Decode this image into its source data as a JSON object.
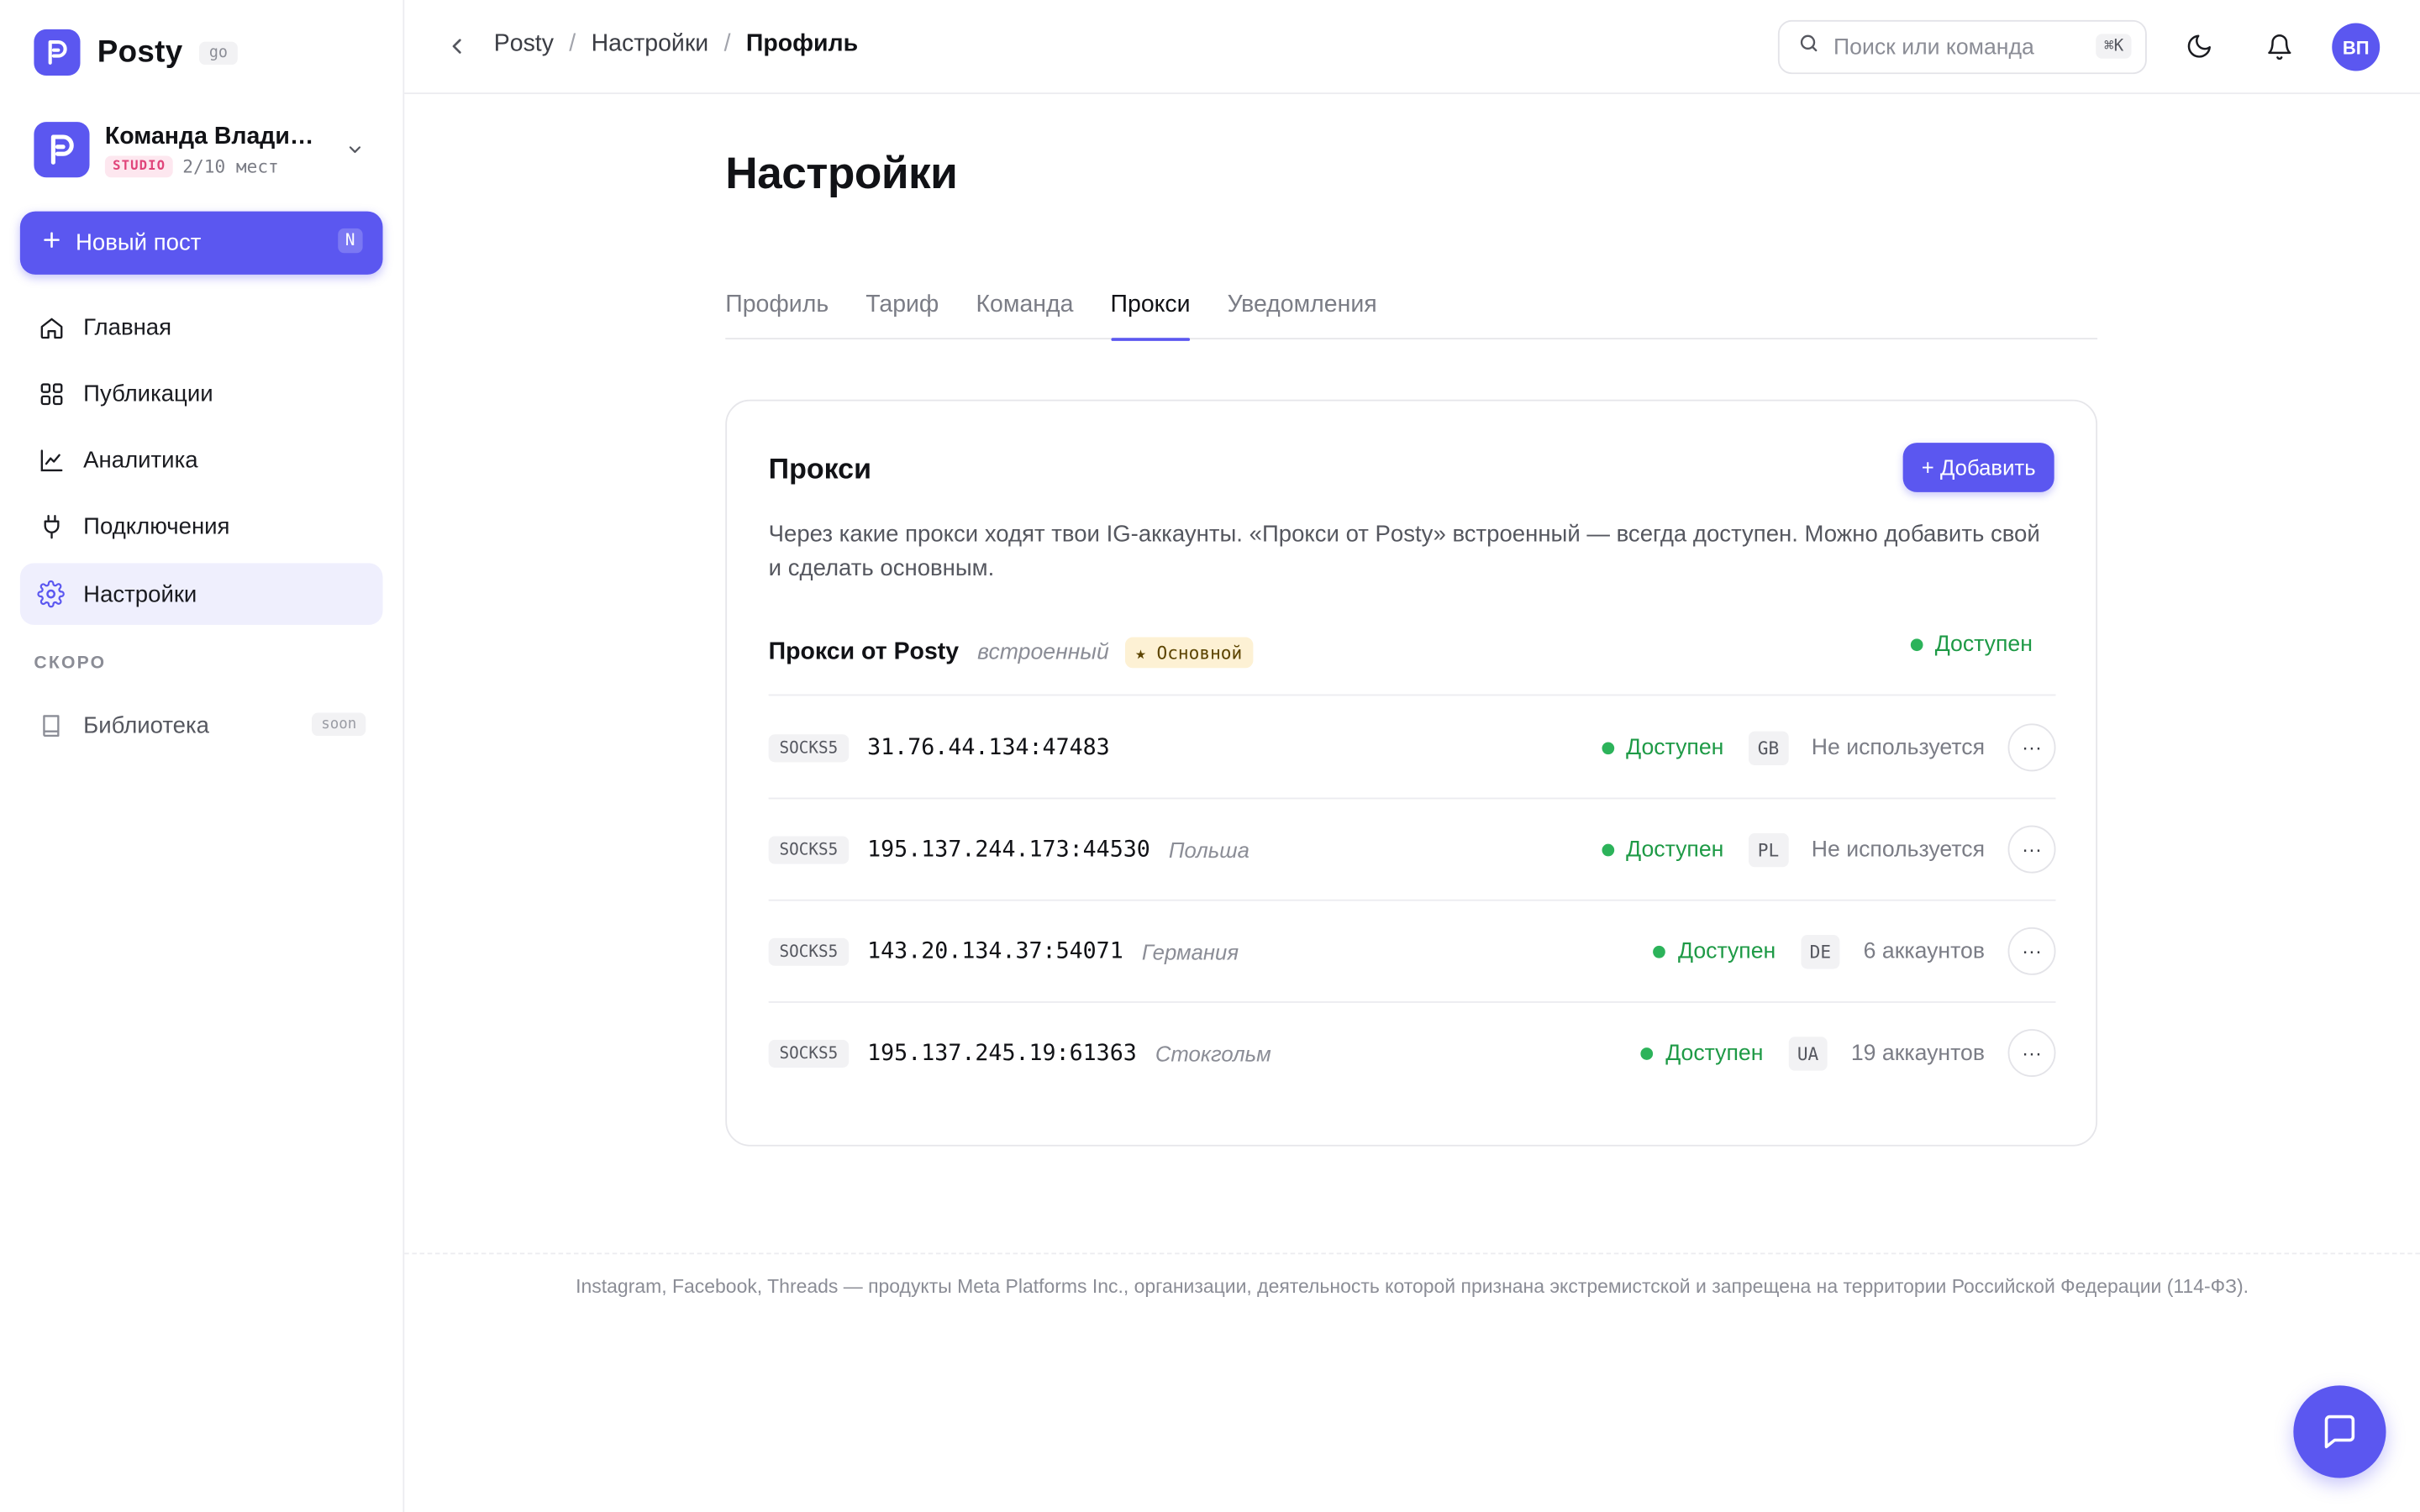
{
  "brand": {
    "name": "Posty",
    "badge": "go"
  },
  "team": {
    "name": "Команда Владимира",
    "plan": "STUDIO",
    "seats": "2/10 мест"
  },
  "new_post": {
    "label": "Новый пост",
    "shortcut": "N"
  },
  "nav": [
    {
      "label": "Главная",
      "icon": "home-icon"
    },
    {
      "label": "Публикации",
      "icon": "grid-icon"
    },
    {
      "label": "Аналитика",
      "icon": "chart-icon"
    },
    {
      "label": "Подключения",
      "icon": "plug-icon"
    },
    {
      "label": "Настройки",
      "icon": "gear-icon",
      "active": true
    }
  ],
  "soon_section": {
    "title": "СКОРО",
    "items": [
      {
        "label": "Библиотека",
        "badge": "soon",
        "icon": "book-icon"
      }
    ]
  },
  "header": {
    "breadcrumb": [
      "Posty",
      "Настройки",
      "Профиль"
    ],
    "search_placeholder": "Поиск или команда",
    "search_value": "",
    "search_shortcut": "⌘K",
    "avatar": "ВП"
  },
  "page": {
    "title": "Настройки"
  },
  "tabs": [
    {
      "label": "Профиль"
    },
    {
      "label": "Тариф"
    },
    {
      "label": "Команда"
    },
    {
      "label": "Прокси",
      "active": true
    },
    {
      "label": "Уведомления"
    }
  ],
  "proxies": {
    "title": "Прокси",
    "add_label": "+ Добавить",
    "description": "Через какие прокси ходят твои IG-аккаунты. «Прокси от Posty» встроенный — всегда доступен. Можно добавить свой и сделать основным.",
    "builtin": {
      "name": "Прокси от Posty",
      "kind": "встроенный",
      "badge": "★ Основной",
      "status": "Доступен"
    },
    "rows": [
      {
        "protocol": "SOCKS5",
        "address": "31.76.44.134:47483",
        "location": "",
        "status": "Доступен",
        "country": "GB",
        "usage": "Не используется"
      },
      {
        "protocol": "SOCKS5",
        "address": "195.137.244.173:44530",
        "location": "Польша",
        "status": "Доступен",
        "country": "PL",
        "usage": "Не используется"
      },
      {
        "protocol": "SOCKS5",
        "address": "143.20.134.37:54071",
        "location": "Германия",
        "status": "Доступен",
        "country": "DE",
        "usage": "6 аккаунтов"
      },
      {
        "protocol": "SOCKS5",
        "address": "195.137.245.19:61363",
        "location": "Стокгольм",
        "status": "Доступен",
        "country": "UA",
        "usage": "19 аккаунтов"
      }
    ],
    "more_icon": "more-horizontal-icon"
  },
  "footer": {
    "text": "Instagram, Facebook, Threads — продукты Meta Platforms Inc., организации, деятельность которой признана экстремистской и запрещена на территории Российской Федерации (114-ФЗ)."
  },
  "colors": {
    "accent": "#5b57f0",
    "success": "#2cb35a",
    "active_nav_bg": "#efeffd",
    "badge_plan": "#e0447a",
    "badge_main_bg": "#fdf1d4"
  }
}
